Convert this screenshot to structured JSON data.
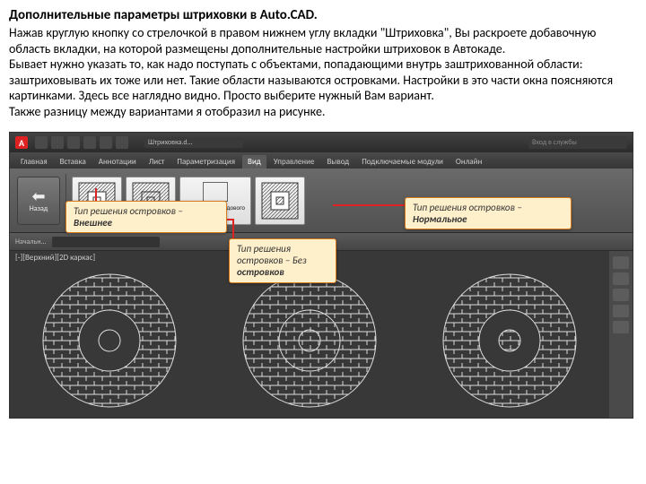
{
  "article": {
    "title": "Дополнительные параметры штриховки в Auto.CAD.",
    "p1": "Нажав круглую кнопку со стрелочкой в правом нижнем углу вкладки \"Штриховка\", Вы раскроете добавочную область вкладки, на которой размещены дополнительные настройки штриховок в Автокаде.",
    "p2": "Бывает нужно указать то, как надо поступать с объектами, попадающими внутрь заштрихованной области: заштриховывать их тоже или нет. Такие области называются островками. Настройки в это части окна поясняются картинками. Здесь все наглядно видно. Просто выберите нужный Вам вариант.",
    "p3": "Также разницу между вариантами я отобразил на рисунке."
  },
  "autocad": {
    "doc_title": "Штриховка.d...",
    "search_placeholder": "Вход в службы",
    "tabs": [
      "Главная",
      "Вставка",
      "Аннотации",
      "Лист",
      "Параметризация",
      "Вид",
      "Управление",
      "Вывод",
      "Подключаемые модули",
      "Онлайн"
    ],
    "active_tab": 5,
    "nav_back": "Назад",
    "viewport_label": "Конфигурация видового экрана",
    "canvas_label": "[-][Верхний][2D каркас]",
    "callouts": {
      "c1_l1": "Тип решения островков –",
      "c1_l2": "Внешнее",
      "c2_l1": "Тип решения",
      "c2_l2": "островков – Без",
      "c2_l3": "островков",
      "c3_l1": "Тип решения островков –",
      "c3_l2": "Нормальное"
    }
  }
}
